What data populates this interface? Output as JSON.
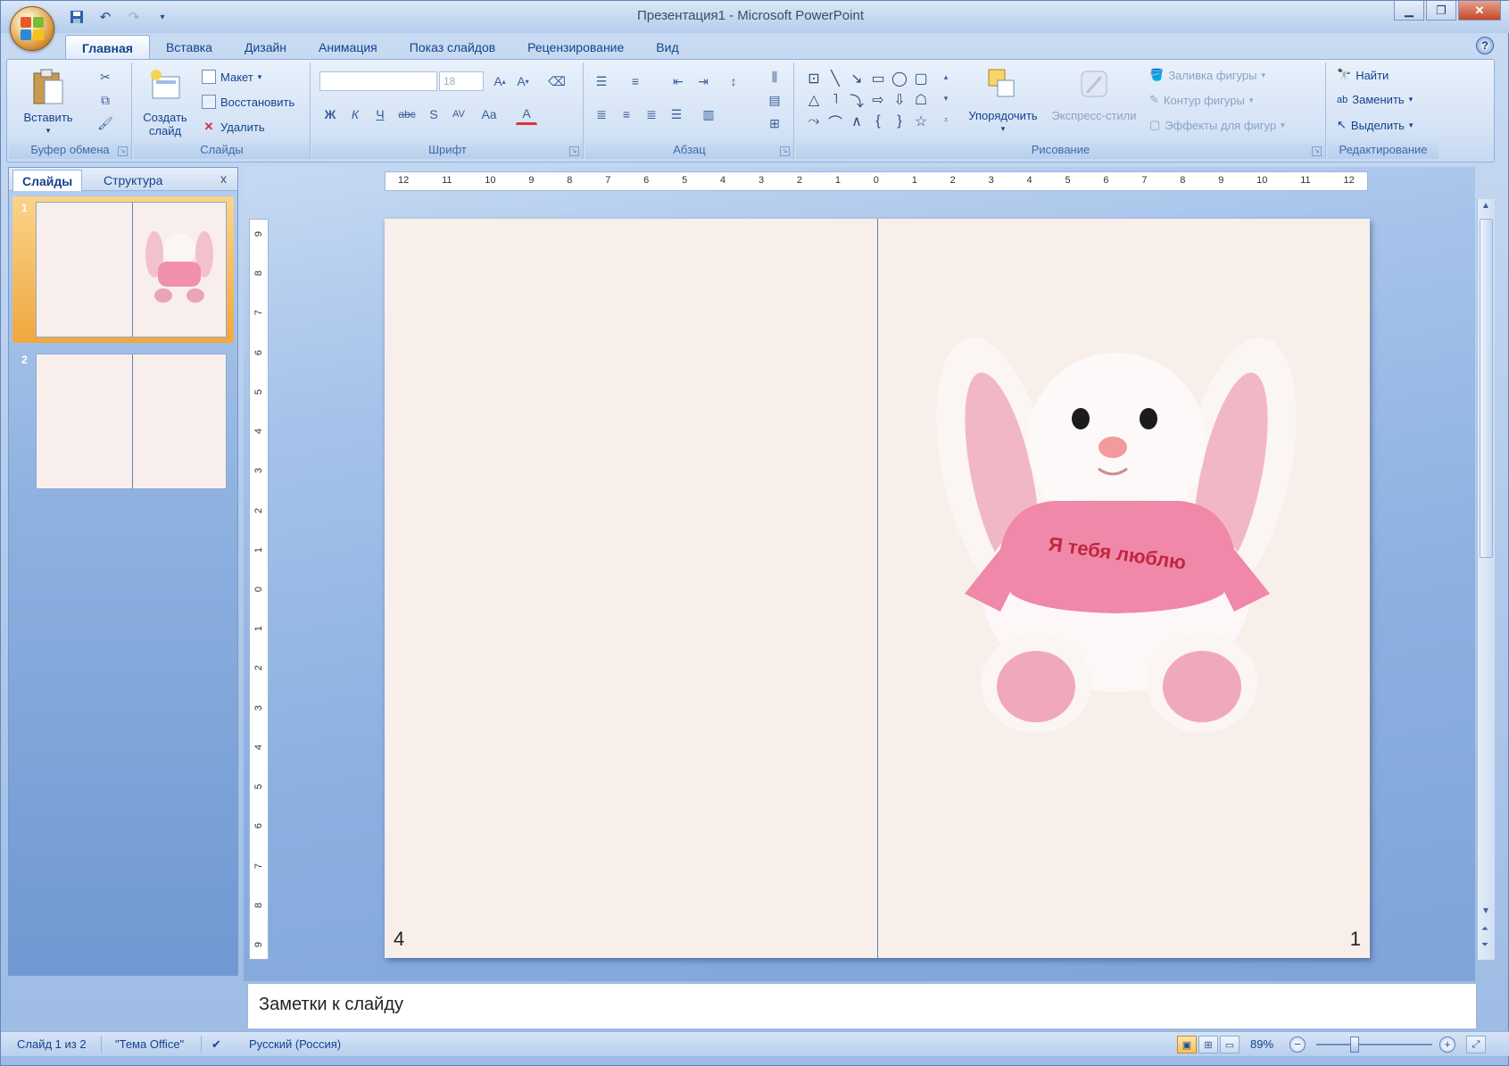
{
  "window": {
    "title": "Презентация1 - Microsoft PowerPoint"
  },
  "quick_access": {
    "save_icon": "save-icon",
    "undo_icon": "undo-icon",
    "redo_icon": "redo-icon",
    "customize_icon": "chevron-down-icon"
  },
  "tabs": [
    {
      "label": "Главная",
      "active": true
    },
    {
      "label": "Вставка"
    },
    {
      "label": "Дизайн"
    },
    {
      "label": "Анимация"
    },
    {
      "label": "Показ слайдов"
    },
    {
      "label": "Рецензирование"
    },
    {
      "label": "Вид"
    }
  ],
  "ribbon": {
    "clipboard": {
      "label": "Буфер обмена",
      "paste": "Вставить"
    },
    "slides": {
      "label": "Слайды",
      "new_slide_1": "Создать",
      "new_slide_2": "слайд",
      "layout": "Макет",
      "reset": "Восстановить",
      "delete": "Удалить"
    },
    "font": {
      "label": "Шрифт",
      "font_name": "",
      "font_size": "18"
    },
    "paragraph": {
      "label": "Абзац"
    },
    "drawing": {
      "label": "Рисование",
      "arrange": "Упорядочить",
      "quick_styles": "Экспресс-стили",
      "fill": "Заливка фигуры",
      "outline": "Контур фигуры",
      "effects": "Эффекты для фигур"
    },
    "editing": {
      "label": "Редактирование",
      "find": "Найти",
      "replace": "Заменить",
      "select": "Выделить"
    }
  },
  "left_panel": {
    "tab_slides": "Слайды",
    "tab_outline": "Структура",
    "close": "x",
    "slides": [
      {
        "number": "1",
        "selected": true,
        "has_image": true
      },
      {
        "number": "2",
        "selected": false,
        "has_image": false
      }
    ]
  },
  "ruler": {
    "h_ticks": [
      "12",
      "11",
      "10",
      "9",
      "8",
      "7",
      "6",
      "5",
      "4",
      "3",
      "2",
      "1",
      "0",
      "1",
      "2",
      "3",
      "4",
      "5",
      "6",
      "7",
      "8",
      "9",
      "10",
      "11",
      "12"
    ],
    "v_ticks": [
      "9",
      "8",
      "7",
      "6",
      "5",
      "4",
      "3",
      "2",
      "1",
      "0",
      "1",
      "2",
      "3",
      "4",
      "5",
      "6",
      "7",
      "8",
      "9"
    ]
  },
  "slide": {
    "page_left": "4",
    "page_right": "1",
    "image": {
      "name": "plush-bunny",
      "shirt_text": "Я тебя люблю"
    }
  },
  "notes": {
    "placeholder": "Заметки к слайду"
  },
  "status": {
    "slide_counter": "Слайд 1 из 2",
    "theme": "\"Тема Office\"",
    "language": "Русский (Россия)",
    "zoom": "89%"
  },
  "colors": {
    "accent": "#f6c15b",
    "ribbon": "#d3e2f5",
    "workspace": "#8cb0e0",
    "slide_bg": "#f8efeb"
  }
}
